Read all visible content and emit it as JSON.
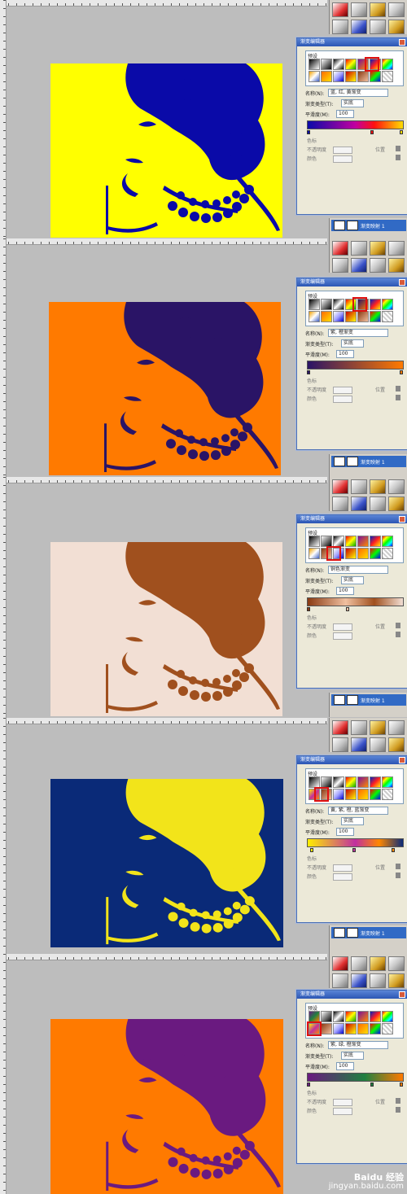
{
  "panels": [
    {
      "bg": "#ffff00",
      "fg": "#0a0aa8",
      "dialog_title": "渐变编辑器",
      "presets_label": "预设",
      "name_label": "名称(N):",
      "name_value": "蓝, 红, 黄渐变",
      "type_label": "渐变类型(T):",
      "type_value": "实底",
      "smooth_label": "平滑度(M):",
      "smooth_value": "100",
      "stops_label": "色标",
      "opacity_label": "不透明度",
      "location_label": "位置",
      "color_label": "颜色",
      "gradient": "linear-gradient(90deg,#0a0aa8,#c000a0 50%,#ff1010 70%,#ffdd00)",
      "layer_name": "渐变映射 1"
    },
    {
      "bg": "#ff7a00",
      "fg": "#2a1466",
      "dialog_title": "渐变编辑器",
      "presets_label": "预设",
      "name_label": "名称(N):",
      "name_value": "紫, 橙渐变",
      "type_label": "渐变类型(T):",
      "type_value": "实底",
      "smooth_label": "平滑度(M):",
      "smooth_value": "100",
      "stops_label": "色标",
      "opacity_label": "不透明度",
      "location_label": "位置",
      "color_label": "颜色",
      "gradient": "linear-gradient(90deg,#2a1466,#ff7a00)",
      "layer_name": "渐变映射 1"
    },
    {
      "bg": "#f2dfd4",
      "fg": "#a0501e",
      "dialog_title": "渐变编辑器",
      "presets_label": "预设",
      "name_label": "名称(N):",
      "name_value": "铜色渐变",
      "type_label": "渐变类型(T):",
      "type_value": "实底",
      "smooth_label": "平滑度(M):",
      "smooth_value": "100",
      "stops_label": "色标",
      "opacity_label": "不透明度",
      "location_label": "位置",
      "color_label": "颜色",
      "gradient": "linear-gradient(90deg,#8a3a12,#f0c0a0 40%,#a0501e 70%,#f2dfd4)",
      "layer_name": "渐变映射 1"
    },
    {
      "bg": "#0a2a78",
      "fg": "#f2e41a",
      "dialog_title": "渐变编辑器",
      "presets_label": "预设",
      "name_label": "名称(N):",
      "name_value": "黄, 紫, 橙, 蓝渐变",
      "type_label": "渐变类型(T):",
      "type_value": "实底",
      "smooth_label": "平滑度(M):",
      "smooth_value": "100",
      "stops_label": "色标",
      "opacity_label": "不透明度",
      "location_label": "位置",
      "color_label": "颜色",
      "gradient": "linear-gradient(90deg,#ffee00,#c030a0 50%,#ff8800 75%,#0a2a78)",
      "layer_name": "渐变映射 1"
    },
    {
      "bg": "#ff7a00",
      "fg": "#6a1a80",
      "dialog_title": "渐变编辑器",
      "presets_label": "预设",
      "name_label": "名称(N):",
      "name_value": "紫, 绿, 橙渐变",
      "type_label": "渐变类型(T):",
      "type_value": "实底",
      "smooth_label": "平滑度(M):",
      "smooth_value": "100",
      "stops_label": "色标",
      "opacity_label": "不透明度",
      "location_label": "位置",
      "color_label": "颜色",
      "gradient": "linear-gradient(90deg,#6a1a80,#208040 60%,#ff7a00)",
      "layer_name": ""
    }
  ],
  "watermark": {
    "logo": "Baidu 经验",
    "url": "jingyan.baidu.com"
  }
}
